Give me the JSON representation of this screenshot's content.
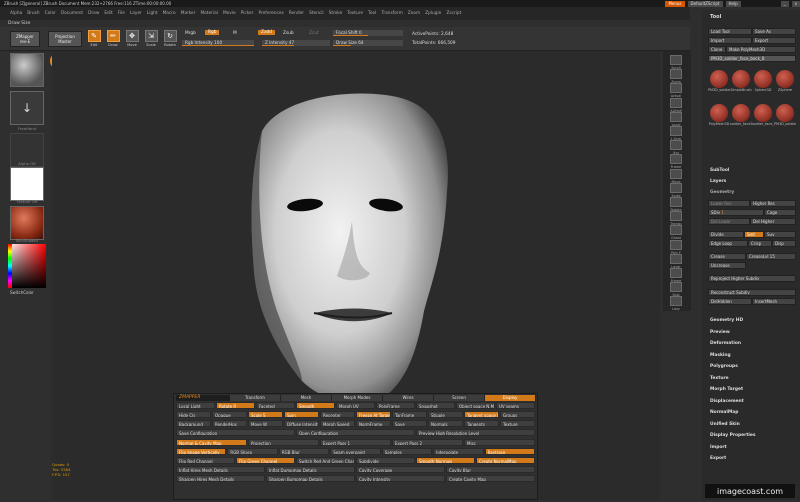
{
  "titlebar": {
    "title": "ZBrush  [ZJgeneral]   ZBrush Document  Mem:232+2766  Free:116  ZTime:00:00:00.00",
    "menus_btn": "Menus",
    "default_script": "DefaultZScript",
    "help": "Help"
  },
  "menu": [
    "Alpha",
    "Brush",
    "Color",
    "Document",
    "Draw",
    "Edit",
    "File",
    "Layer",
    "Light",
    "Macro",
    "Marker",
    "Material",
    "Movie",
    "Picker",
    "Preferences",
    "Render",
    "Stencil",
    "Stroke",
    "Texture",
    "Tool",
    "Transform",
    "Zoom",
    "Zplugin",
    "Zscript"
  ],
  "draw_size_label": "Draw Size",
  "shelf": {
    "zmapper": "ZMapper",
    "zmapper_sub": "rev-E",
    "projection": "Projection",
    "projection_sub": "Master",
    "edit": "Edit",
    "draw": "Draw",
    "move": "Move",
    "scale": "Scale",
    "rotate": "Rotate",
    "mrgb": "Mrgb",
    "rgb": "Rgb",
    "m": "M",
    "zadd": "Zadd",
    "zsub": "Zsub",
    "zcut": "Zcut",
    "rgb_intensity_label": "Rgb Intensity",
    "rgb_intensity": "100",
    "z_intensity_label": "Z Intensity",
    "z_intensity": "47",
    "focal_shift_label": "Focal Shift",
    "focal_shift": "0",
    "draw_size_label": "Draw Size",
    "draw_size": "64",
    "active_points": "ActivePoints: 2,648",
    "total_points": "TotalPoints: 666,509"
  },
  "leftbar": {
    "brush_cap": "",
    "stroke_cap": "FreeHand",
    "alpha_cap": "Alpha Off",
    "texture_cap": "Texture Off",
    "material_cap": "SkinShade4",
    "switch_color": "SwitchColor"
  },
  "right_shelf": [
    "Scroll",
    "Zoom",
    "Actual",
    "AAHalf",
    "Local",
    "L.Sym",
    "Xyz",
    "Frame",
    "Move",
    "Scale",
    "Rotate",
    "Transp",
    "Ghost",
    "Poly F",
    "Layer",
    "Frame",
    "Solo",
    "Lazy"
  ],
  "tool_panel": {
    "title": "Tool",
    "load": "Load Tool",
    "save_as": "Save As",
    "import": "Import",
    "export": "Export",
    "clone": "Clone",
    "make_polymesh": "Make PolyMesh3D",
    "current": "PM3D_soldier_face_beck_8",
    "subtools": [
      {
        "name": "PM3D_soldier_fac"
      },
      {
        "name": "SimpleBrush"
      },
      {
        "name": "Sphere3D"
      },
      {
        "name": "ZSphere"
      },
      {
        "name": "PolyMesh3D"
      },
      {
        "name": "soldier_face2"
      },
      {
        "name": "soldier_face_Fc"
      },
      {
        "name": "PM3D_soldier_fac"
      }
    ],
    "subtool": "SubTool",
    "layers": "Layers",
    "geometry": "Geometry",
    "lower_res": "Lower Res",
    "higher_res": "Higher Res",
    "sdiv_label": "SDiv",
    "sdiv": "1",
    "cage": "Cage",
    "del_lower": "Del Lower",
    "del_higher": "Del Higher",
    "divide": "Divide",
    "smt": "Smt",
    "suv": "Suv",
    "edge_loop": "Edge Loop",
    "crisp": "Crisp",
    "disp": "Disp",
    "crease": "Crease",
    "crease_lvl": "CreaseLvl 15",
    "uncrease": "Uncrease",
    "reproject": "Reproject Higher Subdiv",
    "reconstruct": "Reconstruct Subdiv",
    "delhidden": "DelHidden",
    "insertmesh": "InsertMesh",
    "sections": [
      "Geometry HD",
      "Preview",
      "Deformation",
      "Masking",
      "Polygroups",
      "Texture",
      "Morph Target",
      "Displacement",
      "NormalMap",
      "Unified Skin",
      "Display Properties",
      "Import",
      "Export"
    ]
  },
  "stats": {
    "quads": "Quads: 0",
    "tris": "Tris: 5284",
    "fps": "F.P.S: 157"
  },
  "zmapper": {
    "logo": "ZMAPPER",
    "tabs": [
      "Transform",
      "Mesh",
      "Morph Modes",
      "Wires",
      "Screen",
      "Display"
    ],
    "row1": [
      "Local Light",
      "Rotate R",
      "Faceted",
      "Smooth",
      "Morph UV",
      "PolyFrame",
      "Snapshot",
      "Object space N.Map",
      "UV seams"
    ],
    "row2": [
      "Hide Cls",
      "Opaque",
      "Scale S",
      "Spin",
      "Recenter",
      "Freeze At Target",
      "TanFrame",
      "Stipple",
      "Tangent space N.Map",
      "Groups"
    ],
    "row3": [
      "Background",
      "RenderHps",
      "Move W",
      "Diffuse Intensity",
      "Morph Speed",
      "NormFrame",
      "Save",
      "Normals",
      "Tangents",
      "Texture"
    ],
    "row4": [
      "Save Configuration",
      "Open Configuration",
      "Preview High Resolution Level"
    ],
    "tabs2": [
      "Normal & Cavity Map",
      "Projection",
      "Expert Pass 1",
      "Expert Pass 2",
      "Misc"
    ],
    "row5": [
      "Flip Image Vertically",
      "RGB Sharp",
      "RGB Blur",
      "Seam overpaint",
      "Samples",
      "Interpolate",
      "Raytrace"
    ],
    "row6": [
      "Flip Red Channel",
      "Flip Green Channel",
      "Switch Red And Green Channels",
      "Subdivide",
      "Smooth Normals",
      "Create NormalMap"
    ],
    "row7": [
      "Inflat Hires Mesh Details",
      "Inflat Dumpmap Details",
      "Cavity Coverage",
      "Cavity Blur"
    ],
    "row8": [
      "Sharpen Hires Mesh Details",
      "Sharpen Bumpmap Details",
      "Cavity Intensity",
      "Create Cavity Map"
    ]
  },
  "watermark": "imagecoast.com",
  "colors": {
    "accent": "#d27a1a",
    "bg": "#2e2e2e"
  }
}
